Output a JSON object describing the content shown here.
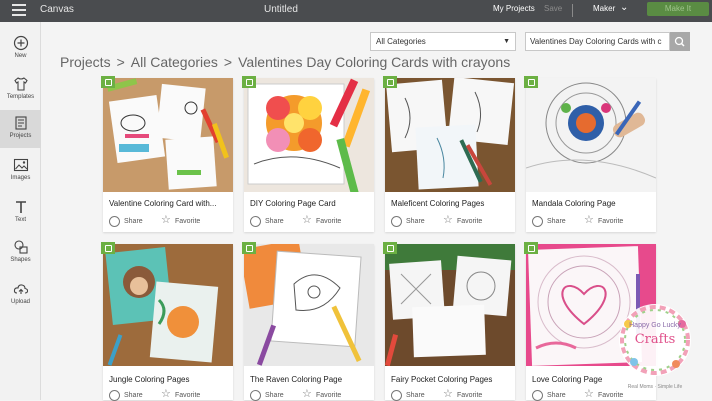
{
  "topbar": {
    "app_name": "Canvas",
    "doc_title": "Untitled",
    "my_projects": "My Projects",
    "save": "Save",
    "machine": "Maker",
    "make_it": "Make It"
  },
  "sidebar": {
    "items": [
      {
        "label": "New",
        "icon": "plus-circle-icon"
      },
      {
        "label": "Templates",
        "icon": "shirt-icon"
      },
      {
        "label": "Projects",
        "icon": "projects-icon"
      },
      {
        "label": "Images",
        "icon": "image-icon"
      },
      {
        "label": "Text",
        "icon": "text-icon"
      },
      {
        "label": "Shapes",
        "icon": "shapes-icon"
      },
      {
        "label": "Upload",
        "icon": "upload-icon"
      }
    ],
    "active": "Projects"
  },
  "breadcrumb": [
    "Projects",
    "All Categories",
    "Valentines Day Coloring Cards with crayons"
  ],
  "filters": {
    "category_value": "All Categories",
    "search_value": "Valentines Day Coloring Cards with c"
  },
  "cards": [
    {
      "title": "Valentine Coloring Card with...",
      "share": "Share",
      "favorite": "Favorite"
    },
    {
      "title": "DIY Coloring Page Card",
      "share": "Share",
      "favorite": "Favorite"
    },
    {
      "title": "Maleficent Coloring Pages",
      "share": "Share",
      "favorite": "Favorite"
    },
    {
      "title": "Mandala Coloring Page",
      "share": "Share",
      "favorite": "Favorite"
    },
    {
      "title": "Jungle Coloring Pages",
      "share": "Share",
      "favorite": "Favorite"
    },
    {
      "title": "The Raven Coloring Page",
      "share": "Share",
      "favorite": "Favorite"
    },
    {
      "title": "Fairy Pocket Coloring Pages",
      "share": "Share",
      "favorite": "Favorite"
    },
    {
      "title": "Love Coloring Page",
      "share": "Share",
      "favorite": "Favorite"
    }
  ],
  "watermark": {
    "line1": "Happy Go Lucky",
    "line2": "Crafts",
    "caption": "Real Moms · Simple Life"
  },
  "colors": {
    "topbar": "#4a4c4f",
    "make_button": "#5a8c43",
    "badge": "#6cb043"
  }
}
